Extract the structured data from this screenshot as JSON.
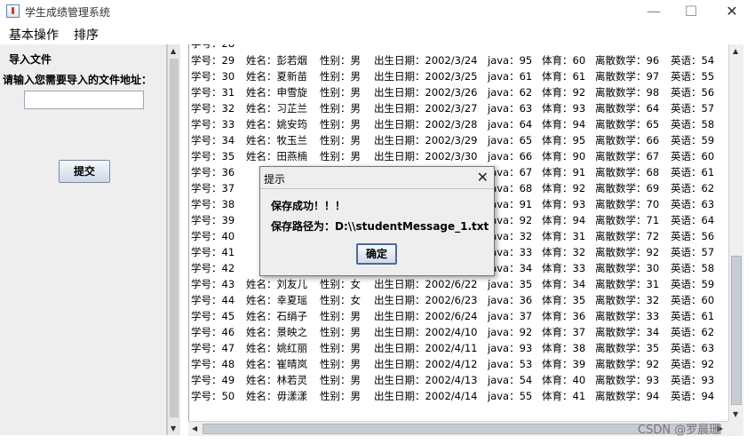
{
  "window": {
    "title": "学生成绩管理系统",
    "minimize": "—",
    "maximize": "☐",
    "close": "✕"
  },
  "menu": {
    "items": [
      "基本操作",
      "排序"
    ]
  },
  "import_panel": {
    "heading": "导入文件",
    "prompt": "请输入您需要导入的文件地址：",
    "input_value": "",
    "submit_label": "提交"
  },
  "table": {
    "columns": [
      "学号",
      "姓名",
      "性别",
      "出生日期",
      "java",
      "体育",
      "离散数学",
      "英语"
    ],
    "rows": [
      {
        "id": "29",
        "name": "彭若烟",
        "sex": "男",
        "birth": "2002/3/24",
        "java": "95",
        "pe": "60",
        "math": "96",
        "eng": "54"
      },
      {
        "id": "30",
        "name": "夏新苗",
        "sex": "男",
        "birth": "2002/3/25",
        "java": "61",
        "pe": "61",
        "math": "97",
        "eng": "55"
      },
      {
        "id": "31",
        "name": "申雪旋",
        "sex": "男",
        "birth": "2002/3/26",
        "java": "62",
        "pe": "92",
        "math": "98",
        "eng": "56"
      },
      {
        "id": "32",
        "name": "习芷兰",
        "sex": "男",
        "birth": "2002/3/27",
        "java": "63",
        "pe": "93",
        "math": "64",
        "eng": "57"
      },
      {
        "id": "33",
        "name": "姚安筠",
        "sex": "男",
        "birth": "2002/3/28",
        "java": "64",
        "pe": "94",
        "math": "65",
        "eng": "58"
      },
      {
        "id": "34",
        "name": "牧玉兰",
        "sex": "男",
        "birth": "2002/3/29",
        "java": "65",
        "pe": "95",
        "math": "66",
        "eng": "59"
      },
      {
        "id": "35",
        "name": "田燕楠",
        "sex": "男",
        "birth": "2002/3/30",
        "java": "66",
        "pe": "90",
        "math": "67",
        "eng": "60"
      },
      {
        "id": "36",
        "name": "",
        "sex": "",
        "birth": "",
        "java": "67",
        "pe": "91",
        "math": "68",
        "eng": "61"
      },
      {
        "id": "37",
        "name": "",
        "sex": "",
        "birth": "",
        "java": "68",
        "pe": "92",
        "math": "69",
        "eng": "62"
      },
      {
        "id": "38",
        "name": "",
        "sex": "",
        "birth": "",
        "java": "91",
        "pe": "93",
        "math": "70",
        "eng": "63"
      },
      {
        "id": "39",
        "name": "",
        "sex": "",
        "birth": "",
        "java": "92",
        "pe": "94",
        "math": "71",
        "eng": "64"
      },
      {
        "id": "40",
        "name": "",
        "sex": "",
        "birth": "",
        "java": "32",
        "pe": "31",
        "math": "72",
        "eng": "56"
      },
      {
        "id": "41",
        "name": "",
        "sex": "",
        "birth": "",
        "java": "33",
        "pe": "32",
        "math": "92",
        "eng": "57"
      },
      {
        "id": "42",
        "name": "",
        "sex": "",
        "birth": "",
        "java": "34",
        "pe": "33",
        "math": "30",
        "eng": "58"
      },
      {
        "id": "43",
        "name": "刘友儿",
        "sex": "女",
        "birth": "2002/6/22",
        "java": "35",
        "pe": "34",
        "math": "31",
        "eng": "59"
      },
      {
        "id": "44",
        "name": "幸夏瑶",
        "sex": "女",
        "birth": "2002/6/23",
        "java": "36",
        "pe": "35",
        "math": "32",
        "eng": "60"
      },
      {
        "id": "45",
        "name": "石绢子",
        "sex": "男",
        "birth": "2002/6/24",
        "java": "37",
        "pe": "36",
        "math": "33",
        "eng": "61"
      },
      {
        "id": "46",
        "name": "景映之",
        "sex": "男",
        "birth": "2002/4/10",
        "java": "92",
        "pe": "37",
        "math": "34",
        "eng": "62"
      },
      {
        "id": "47",
        "name": "姚红丽",
        "sex": "男",
        "birth": "2002/4/11",
        "java": "93",
        "pe": "38",
        "math": "35",
        "eng": "63"
      },
      {
        "id": "48",
        "name": "崔晴岚",
        "sex": "男",
        "birth": "2002/4/12",
        "java": "53",
        "pe": "39",
        "math": "92",
        "eng": "92"
      },
      {
        "id": "49",
        "name": "林若灵",
        "sex": "男",
        "birth": "2002/4/13",
        "java": "54",
        "pe": "40",
        "math": "93",
        "eng": "93"
      },
      {
        "id": "50",
        "name": "毋漾漾",
        "sex": "男",
        "birth": "2002/4/14",
        "java": "55",
        "pe": "41",
        "math": "94",
        "eng": "94"
      }
    ]
  },
  "dialog": {
    "title": "提示",
    "message": "保存成功！！！",
    "path_text": "保存路径为：D:\\\\studentMessage_1.txt",
    "ok_label": "确定",
    "close": "✕"
  },
  "watermark": "CSDN @罗晨珊"
}
